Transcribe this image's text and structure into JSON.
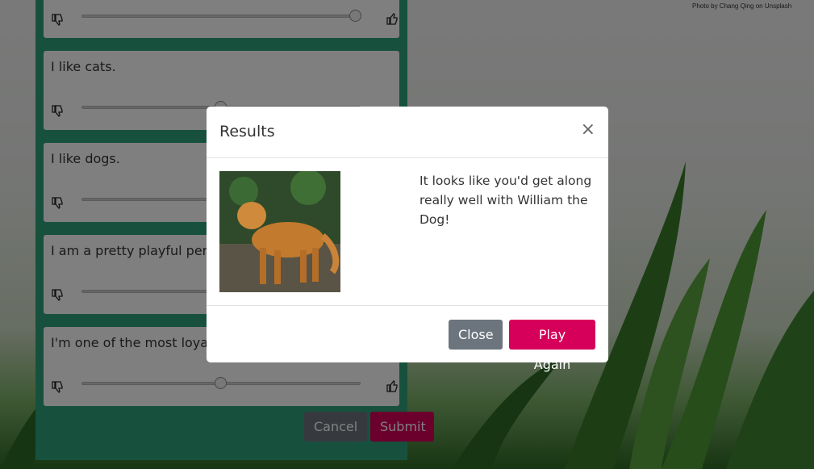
{
  "background": {
    "photo_credit": "Photo by Chang Qing on Unsplash"
  },
  "quiz": {
    "questions": [
      {
        "text": "",
        "slider_value": 1.0
      },
      {
        "text": "I like cats.",
        "slider_value": 0.5
      },
      {
        "text": "I like dogs.",
        "slider_value": 0.5
      },
      {
        "text": "I am a pretty playful person.",
        "slider_value": 0.5
      },
      {
        "text": "I'm one of the most loyal people you'll meet.",
        "slider_value": 0.5
      }
    ],
    "cancel_label": "Cancel",
    "submit_label": "Submit"
  },
  "modal": {
    "title": "Results",
    "close_symbol": "×",
    "result_text": "It looks like you'd get along really well with William the Dog!",
    "image_icon": "dog-photo",
    "close_label": "Close",
    "play_again_label": "Play Again"
  },
  "colors": {
    "panel": "#2fa37d",
    "primary_button": "#d6005a",
    "secondary_button": "#6c757d"
  }
}
